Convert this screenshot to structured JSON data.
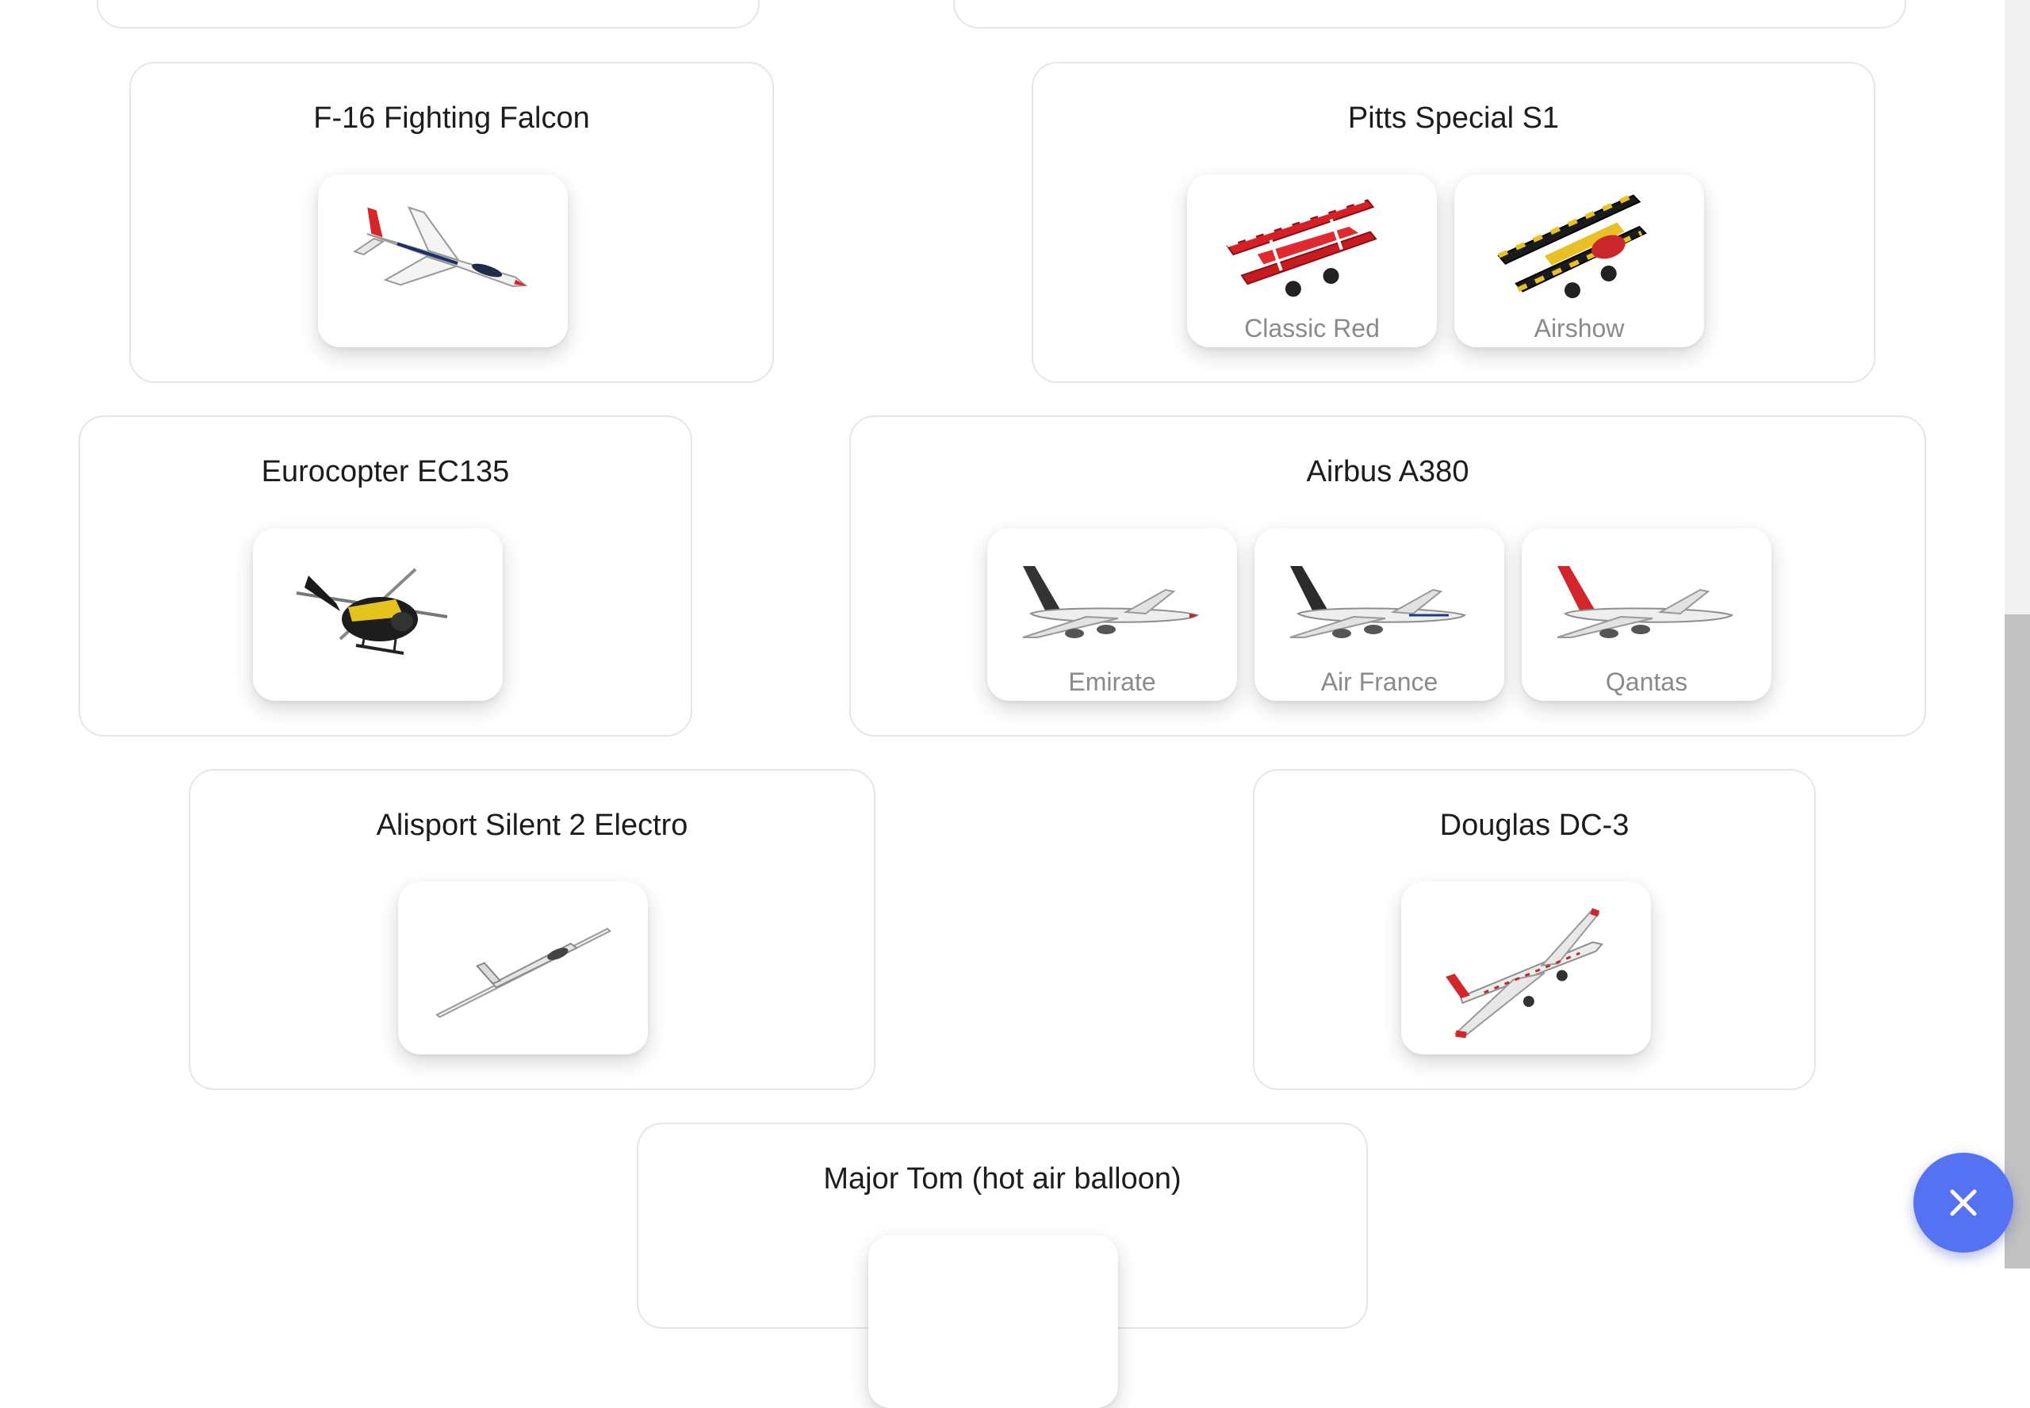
{
  "aircraft": [
    {
      "name": "F-16 Fighting Falcon",
      "variants": [
        {
          "label": "",
          "icon": "f16-jet-icon"
        }
      ]
    },
    {
      "name": "Pitts Special S1",
      "variants": [
        {
          "label": "Classic Red",
          "icon": "red-biplane-icon"
        },
        {
          "label": "Airshow",
          "icon": "black-yellow-biplane-icon"
        }
      ]
    },
    {
      "name": "Eurocopter EC135",
      "variants": [
        {
          "label": "",
          "icon": "helicopter-icon"
        }
      ]
    },
    {
      "name": "Airbus A380",
      "variants": [
        {
          "label": "Emirate",
          "icon": "airliner-icon"
        },
        {
          "label": "Air France",
          "icon": "airliner-icon"
        },
        {
          "label": "Qantas",
          "icon": "airliner-icon"
        }
      ]
    },
    {
      "name": "Alisport Silent 2 Electro",
      "variants": [
        {
          "label": "",
          "icon": "glider-icon"
        }
      ]
    },
    {
      "name": "Douglas DC-3",
      "variants": [
        {
          "label": "",
          "icon": "propeller-airliner-icon"
        }
      ]
    },
    {
      "name": "Major Tom (hot air balloon)",
      "variants": [
        {
          "label": "",
          "icon": "hot-air-balloon-icon"
        }
      ]
    }
  ],
  "close_button": {
    "icon": "close-icon"
  },
  "colors": {
    "accent": "#5472f2",
    "card_border": "#e6e6e6",
    "label": "#8a8a8a"
  }
}
